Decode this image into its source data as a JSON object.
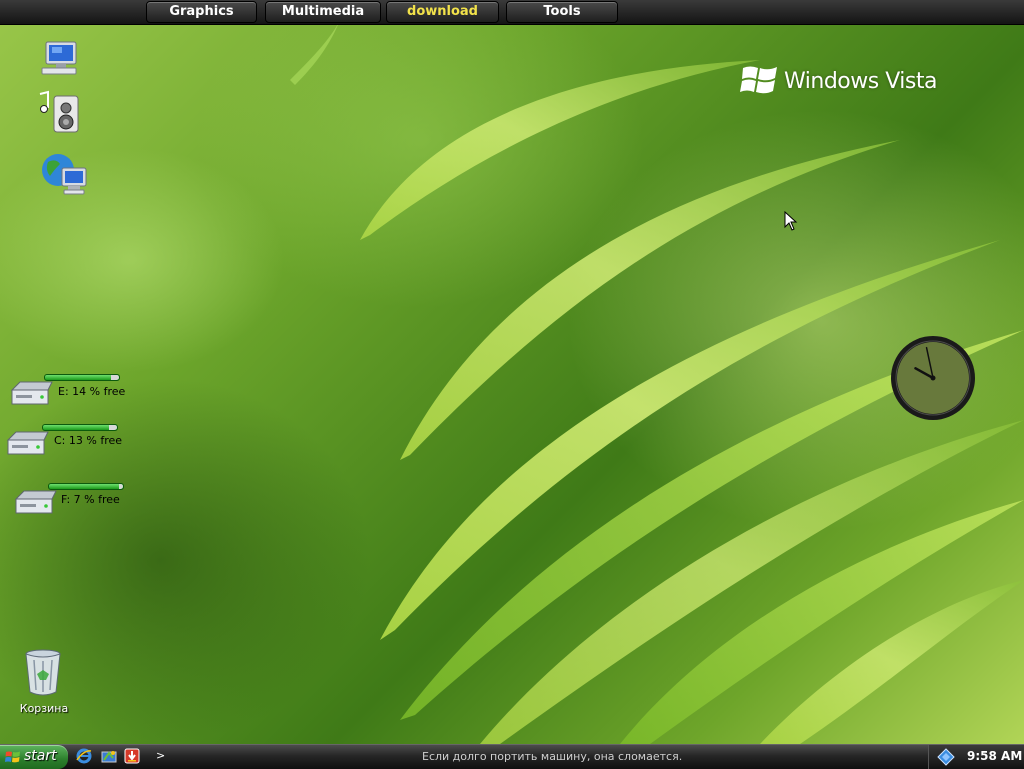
{
  "top_bar": {
    "buttons": [
      {
        "label": "Graphics"
      },
      {
        "label": "Multimedia"
      },
      {
        "label": "download"
      },
      {
        "label": "Tools"
      }
    ]
  },
  "wallpaper": {
    "logo_text": "Windows Vista"
  },
  "desktop": {
    "icons": [
      {
        "icon": "my-computer-icon"
      },
      {
        "icon": "my-music-icon"
      },
      {
        "icon": "network-places-icon"
      }
    ],
    "recycle_bin": {
      "label": "Корзина",
      "icon": "recycle-bin-icon"
    }
  },
  "drives": [
    {
      "label": "E: 14 % free",
      "free_fraction": 0.14
    },
    {
      "label": "C: 13 % free",
      "free_fraction": 0.13
    },
    {
      "label": "F: 7 % free",
      "free_fraction": 0.07
    }
  ],
  "clock_widget": {
    "hour": 9,
    "minute": 58
  },
  "taskbar": {
    "start_label": "start",
    "quick_launch": [
      {
        "icon": "internet-explorer-icon"
      },
      {
        "icon": "show-desktop-icon"
      },
      {
        "icon": "download-manager-icon"
      }
    ],
    "chevron": ">",
    "message": "Если долго портить машину, она сломается.",
    "tray_icon": "network-icon",
    "time": "9:58 AM"
  },
  "colors": {
    "accent_download": "#f2e24a",
    "start_green": "#2c7f2c",
    "drive_bar_green": "#1c9a1c"
  }
}
